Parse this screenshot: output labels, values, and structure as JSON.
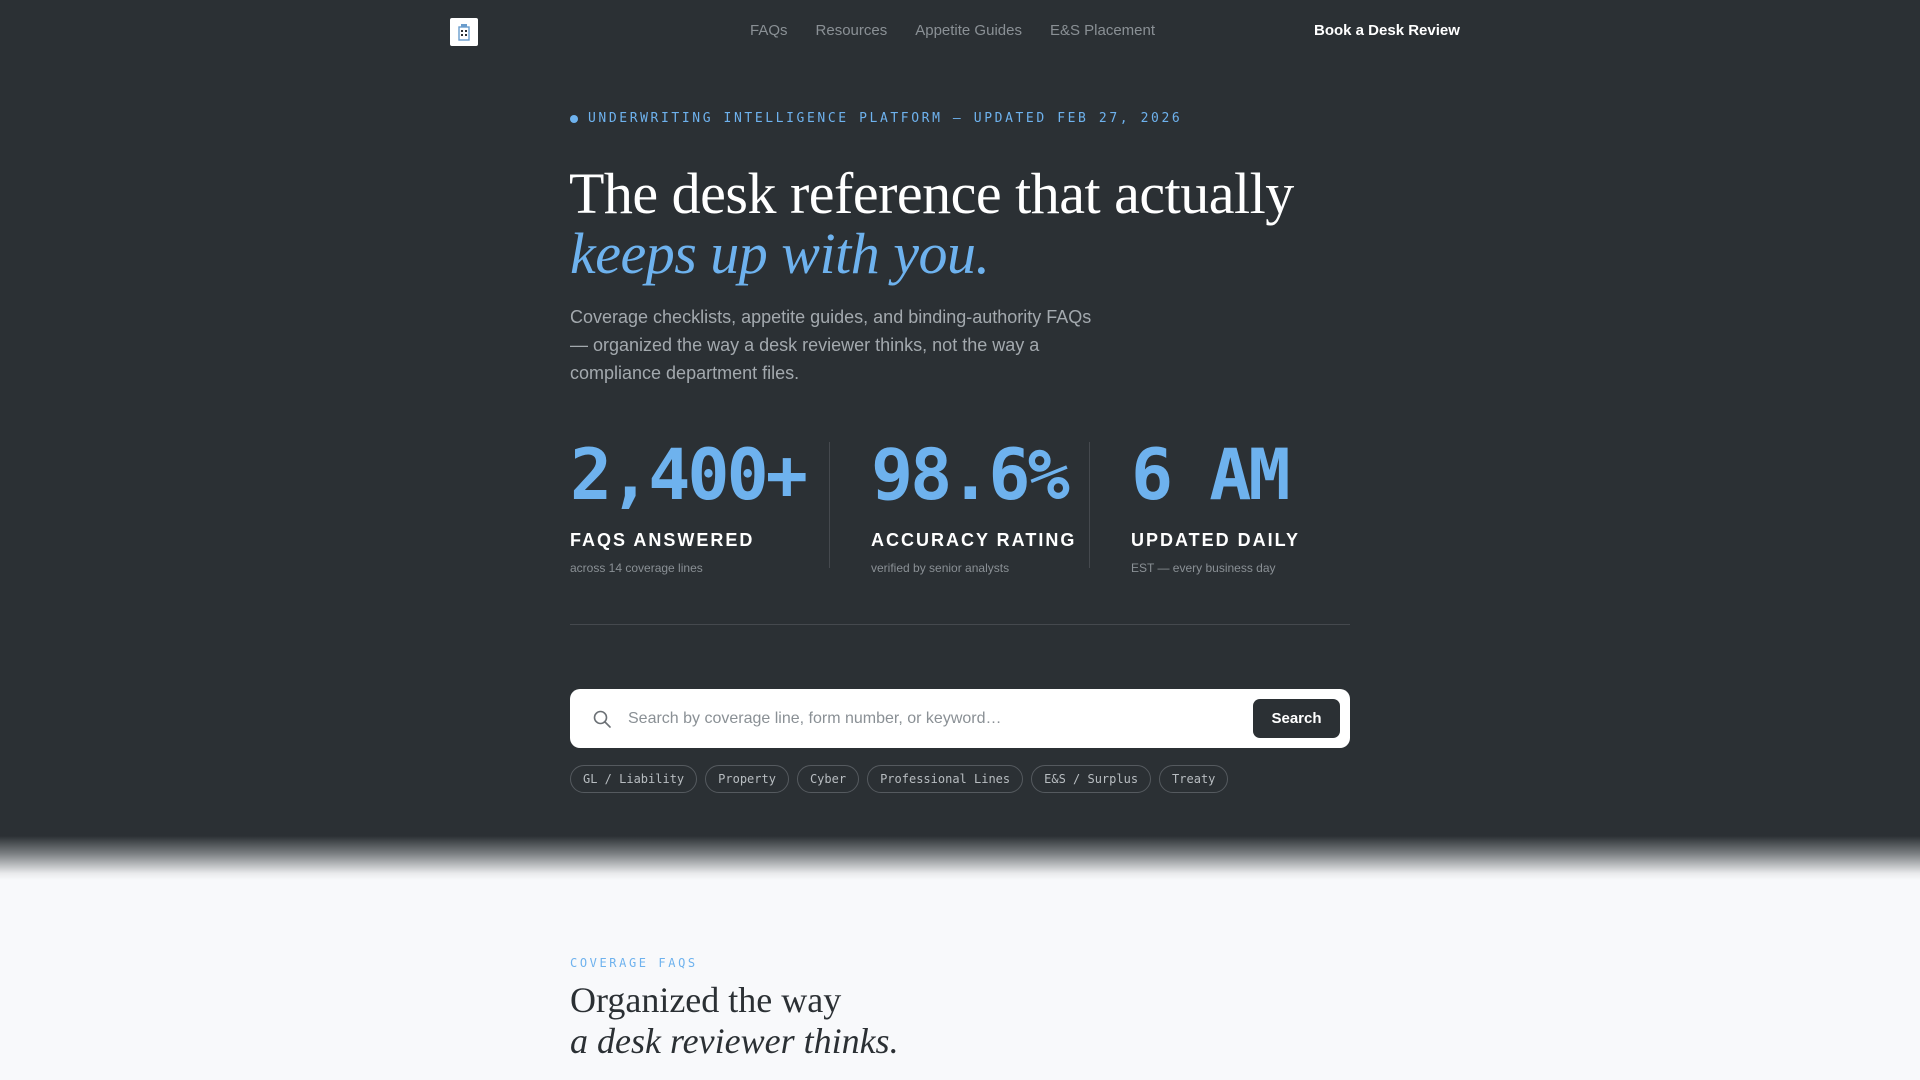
{
  "nav": {
    "logo_icon": "building-icon",
    "links": [
      {
        "label": "FAQs"
      },
      {
        "label": "Resources"
      },
      {
        "label": "Appetite Guides"
      },
      {
        "label": "E&S Placement"
      }
    ],
    "cta_label": "Book a Desk Review"
  },
  "hero": {
    "eyebrow": "UNDERWRITING INTELLIGENCE PLATFORM — UPDATED FEB 27, 2026",
    "title_line1": "The desk reference that actually",
    "title_line2": "keeps up with you.",
    "subtitle": "Coverage checklists, appetite guides, and binding-authority FAQs — organized the way a desk reviewer thinks, not the way a compliance department files."
  },
  "stats": [
    {
      "value": "2,400+",
      "label": "FAQS ANSWERED",
      "note": "across 14 coverage lines"
    },
    {
      "value": "98.6%",
      "label": "ACCURACY RATING",
      "note": "verified by senior analysts"
    },
    {
      "value": "6 AM",
      "label": "UPDATED DAILY",
      "note": "EST — every business day"
    }
  ],
  "search": {
    "placeholder": "Search by coverage line, form number, or keyword…",
    "value": "",
    "button_label": "Search",
    "icon": "search-icon"
  },
  "chips": [
    {
      "label": "GL / Liability"
    },
    {
      "label": "Property"
    },
    {
      "label": "Cyber"
    },
    {
      "label": "Professional Lines"
    },
    {
      "label": "E&S / Surplus"
    },
    {
      "label": "Treaty"
    }
  ],
  "coverage_section": {
    "eyebrow": "COVERAGE FAQS",
    "title_line1": "Organized the way",
    "title_line2": "a desk reviewer thinks."
  },
  "colors": {
    "hero_bg": "#2b3034",
    "accent": "#6eb2ee",
    "page_bg": "#f8f9fb"
  }
}
